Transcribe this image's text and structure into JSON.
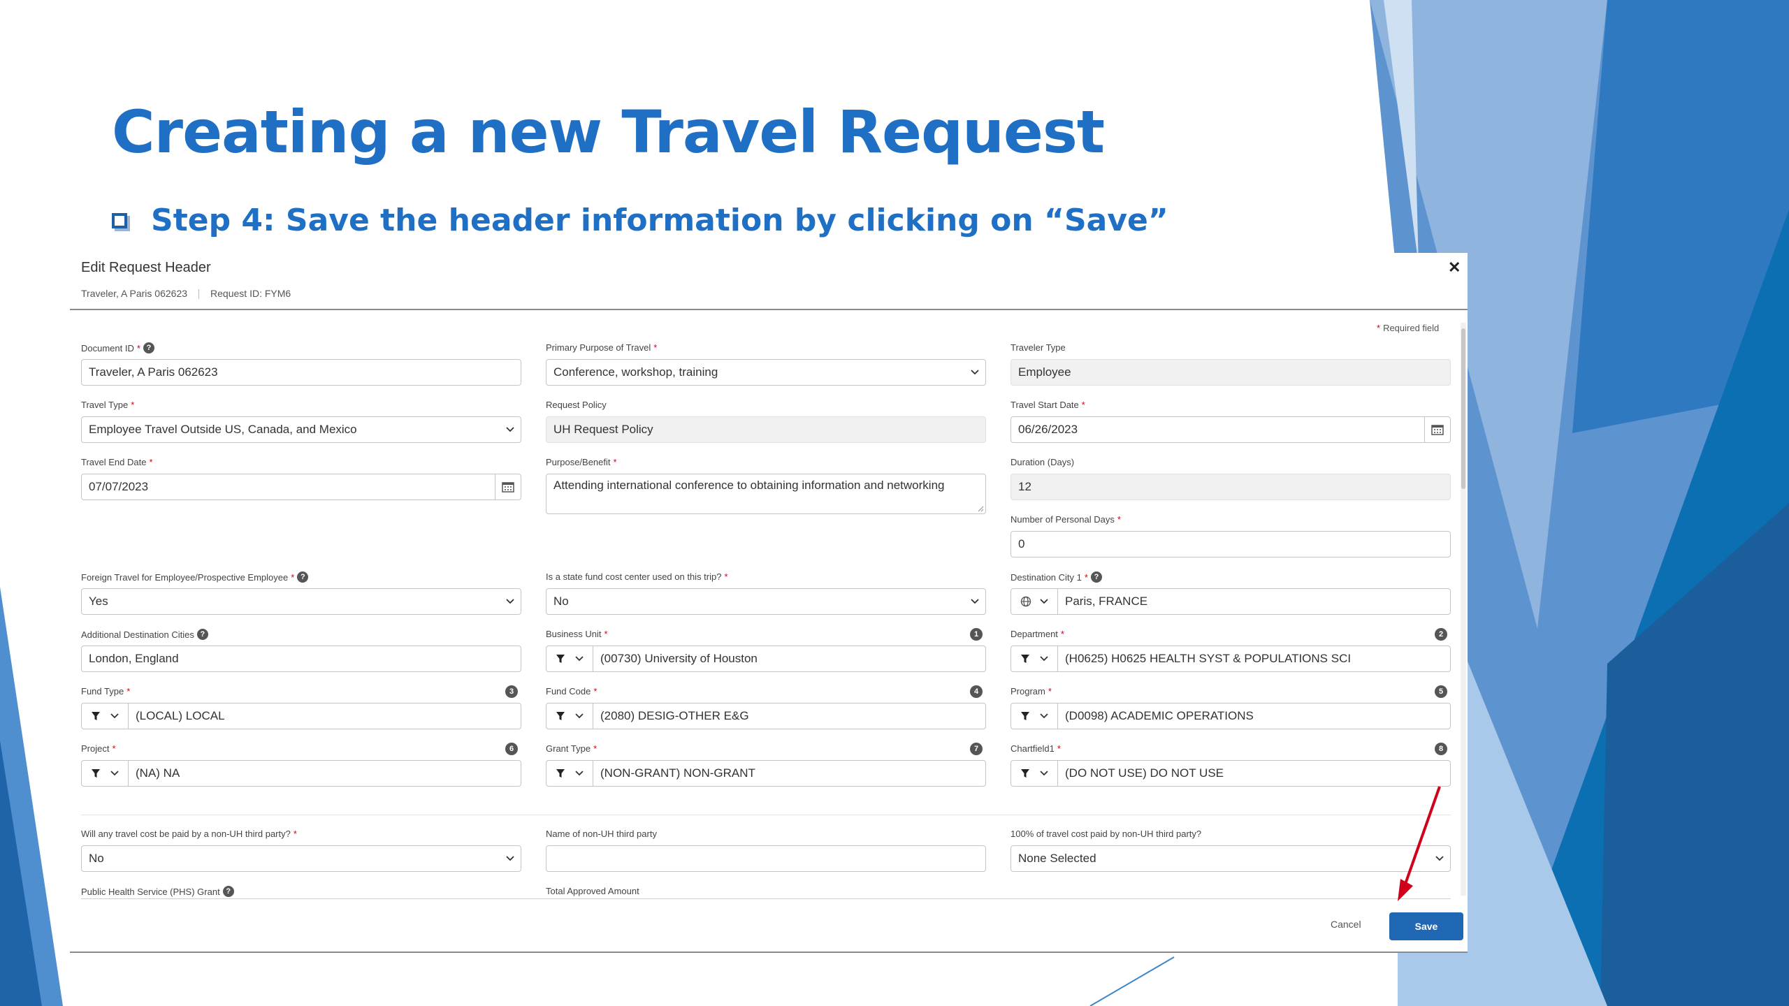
{
  "slide": {
    "title": "Creating a new Travel Request",
    "step": "Step 4: Save the header information by clicking on “Save”",
    "bullet_icon": "square-bullet-icon"
  },
  "colors": {
    "title_blue": "#1f6fc4",
    "button_blue": "#2168b4",
    "required_red": "#d0021b",
    "arrow_red": "#d0021b"
  },
  "dialog": {
    "title": "Edit Request Header",
    "traveler": "Traveler, A Paris 062623",
    "request_id": "Request ID: FYM6",
    "required_note": "Required field",
    "required_marker": "*",
    "help_glyph": "?",
    "fields": {
      "document_id": {
        "label": "Document ID",
        "value": "Traveler, A Paris 062623"
      },
      "primary_purpose": {
        "label": "Primary Purpose of Travel",
        "value": "Conference, workshop, training"
      },
      "traveler_type": {
        "label": "Traveler Type",
        "value": "Employee"
      },
      "travel_type": {
        "label": "Travel Type",
        "value": "Employee Travel Outside US, Canada, and Mexico"
      },
      "request_policy": {
        "label": "Request Policy",
        "value": "UH Request Policy"
      },
      "travel_start_date": {
        "label": "Travel Start Date",
        "value": "06/26/2023"
      },
      "travel_end_date": {
        "label": "Travel End Date",
        "value": "07/07/2023"
      },
      "purpose_benefit": {
        "label": "Purpose/Benefit",
        "value": "Attending international conference to obtaining information and networking"
      },
      "duration_days": {
        "label": "Duration (Days)",
        "value": "12"
      },
      "personal_days": {
        "label": "Number of Personal Days",
        "value": "0"
      },
      "foreign_travel": {
        "label": "Foreign Travel for Employee/Prospective Employee",
        "value": "Yes"
      },
      "state_fund": {
        "label": "Is a state fund cost center used on this trip?",
        "value": "No"
      },
      "destination_city": {
        "label": "Destination City 1",
        "value": "Paris, FRANCE"
      },
      "additional_cities": {
        "label": "Additional Destination Cities",
        "value": "London, England"
      },
      "business_unit": {
        "label": "Business Unit",
        "value": "(00730) University of Houston",
        "badge": "1"
      },
      "department": {
        "label": "Department",
        "value": "(H0625) H0625 HEALTH SYST & POPULATIONS SCI",
        "badge": "2"
      },
      "fund_type": {
        "label": "Fund Type",
        "value": "(LOCAL) LOCAL",
        "badge": "3"
      },
      "fund_code": {
        "label": "Fund Code",
        "value": "(2080) DESIG-OTHER E&G",
        "badge": "4"
      },
      "program": {
        "label": "Program",
        "value": "(D0098) ACADEMIC OPERATIONS",
        "badge": "5"
      },
      "project": {
        "label": "Project",
        "value": "(NA) NA",
        "badge": "6"
      },
      "grant_type": {
        "label": "Grant Type",
        "value": "(NON-GRANT) NON-GRANT",
        "badge": "7"
      },
      "chartfield1": {
        "label": "Chartfield1",
        "value": "(DO NOT USE) DO NOT USE",
        "badge": "8"
      },
      "third_party_paid": {
        "label": "Will any travel cost be paid by a non-UH third party?",
        "value": "No"
      },
      "third_party_name": {
        "label": "Name of non-UH third party",
        "value": ""
      },
      "third_party_full": {
        "label": "100% of travel cost paid by non-UH third party?",
        "value": "None Selected"
      },
      "phs_grant": {
        "label": "Public Health Service (PHS) Grant"
      },
      "total_approved": {
        "label": "Total Approved Amount"
      }
    },
    "cancel_label": "Cancel",
    "save_label": "Save"
  }
}
